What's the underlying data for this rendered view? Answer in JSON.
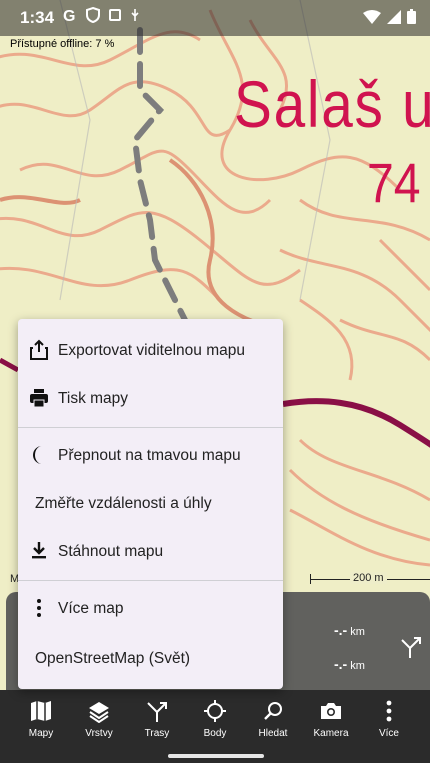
{
  "status_bar": {
    "time": "1:34"
  },
  "map": {
    "offline_status": "Přístupné offline: 7 %",
    "place_name": "Salaš u",
    "place_elevation": "74",
    "scale_left": "M",
    "scale_label": "200 m"
  },
  "stats": {
    "first_value": "-.-",
    "first_unit": "km",
    "second_value": "-.-",
    "second_unit": "km"
  },
  "menu": {
    "items": [
      {
        "label": "Exportovat viditelnou mapu",
        "icon": "share-export-icon"
      },
      {
        "label": "Tisk mapy",
        "icon": "printer-icon"
      },
      {
        "label": "Přepnout na tmavou mapu",
        "icon": "moon-icon"
      },
      {
        "label": "Změřte vzdálenosti a úhly",
        "icon": ""
      },
      {
        "label": "Stáhnout mapu",
        "icon": "download-icon"
      },
      {
        "label": "Více map",
        "icon": "more-vert-icon"
      },
      {
        "label": "OpenStreetMap (Svět)",
        "icon": ""
      }
    ]
  },
  "toolbar": {
    "items": [
      {
        "label": "Mapy",
        "icon": "map-icon"
      },
      {
        "label": "Vrstvy",
        "icon": "layers-icon"
      },
      {
        "label": "Trasy",
        "icon": "route-icon"
      },
      {
        "label": "Body",
        "icon": "crosshair-icon"
      },
      {
        "label": "Hledat",
        "icon": "search-icon"
      },
      {
        "label": "Kamera",
        "icon": "camera-icon"
      },
      {
        "label": "Více",
        "icon": "more-vert-icon"
      }
    ]
  }
}
